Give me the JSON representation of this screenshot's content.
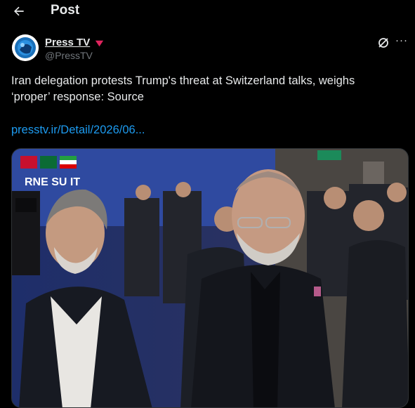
{
  "header": {
    "title": "Post",
    "back_icon": "arrow-left-icon"
  },
  "author": {
    "name": "Press TV",
    "handle": "@PressTV",
    "badge_icon": "verified-badge-icon",
    "badge_color": "#e0245e",
    "avatar_icon": "press-tv-logo"
  },
  "actions": {
    "grok_icon": "grok-icon",
    "more_icon": "more-horizontal-icon",
    "more_glyph": "···"
  },
  "post": {
    "text": "Iran delegation protests Trump's threat at Switzerland talks, weighs ‘proper’ response: Source",
    "link": "presstv.ir/Detail/2026/06..."
  },
  "media": {
    "banner_text": "RNE SU    IT",
    "colors": {
      "link": "#1d9bf0",
      "banner": "#2f4aa0",
      "exit_sign": "#1c8a5a"
    }
  }
}
